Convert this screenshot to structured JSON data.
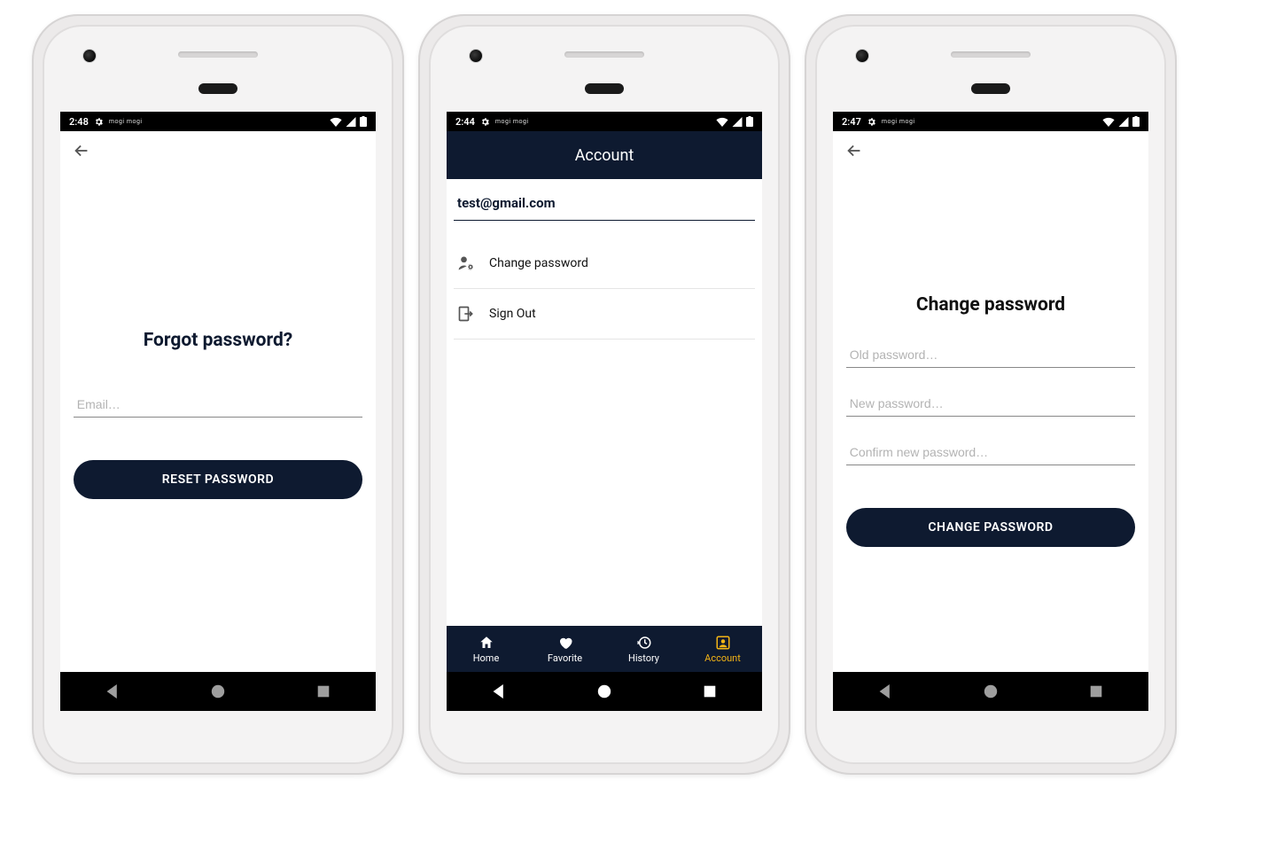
{
  "status": {
    "times": [
      "2:48",
      "2:44",
      "2:47"
    ],
    "extra": "mogi  mogi"
  },
  "forgot": {
    "heading": "Forgot password?",
    "email_placeholder": "Email…",
    "button": "RESET PASSWORD"
  },
  "account": {
    "title": "Account",
    "email": "test@gmail.com",
    "rows": [
      {
        "label": "Change password"
      },
      {
        "label": "Sign Out"
      }
    ],
    "tabs": [
      {
        "label": "Home"
      },
      {
        "label": "Favorite"
      },
      {
        "label": "History"
      },
      {
        "label": "Account"
      }
    ]
  },
  "change": {
    "heading": "Change password",
    "old_placeholder": "Old password…",
    "new_placeholder": "New password…",
    "confirm_placeholder": "Confirm new password…",
    "button": "CHANGE PASSWORD"
  },
  "colors": {
    "navy": "#0e1a30",
    "accent": "#f2b416"
  }
}
